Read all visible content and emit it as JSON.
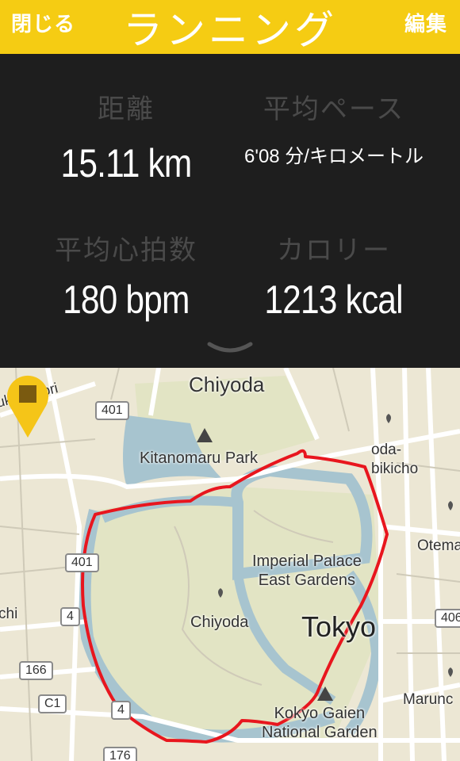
{
  "header": {
    "close_label": "閉じる",
    "title": "ランニング",
    "edit_label": "編集"
  },
  "stats": {
    "distance": {
      "label": "距離",
      "value": "15.11 km"
    },
    "pace": {
      "label": "平均ペース",
      "value": "6'08 分/キロメートル"
    },
    "heart_rate": {
      "label": "平均心拍数",
      "value": "180 bpm"
    },
    "calories": {
      "label": "カロリー",
      "value": "1213 kcal"
    }
  },
  "map": {
    "places": {
      "chiyoda_top": "Chiyoda",
      "kitanomaru_park": "Kitanomaru Park",
      "imperial_line1": "Imperial Palace",
      "imperial_line2": "East Gardens",
      "chiyoda_mid": "Chiyoda",
      "tokyo": "Tokyo",
      "kokyo_line1": "Kokyo Gaien",
      "kokyo_line2": "National Garden",
      "otema": "Otema",
      "marunouchi": "Marunc",
      "jimbocho_line1": "oda-",
      "jimbocho_line2": "bikicho",
      "yasukuni": "ukuni-dori",
      "chi": "chi"
    },
    "road_shields": {
      "r401a": "401",
      "r401b": "401",
      "r4a": "4",
      "r166": "166",
      "rc1": "C1",
      "r4b": "4",
      "r176": "176",
      "r406": "406"
    },
    "colors": {
      "route": "#e8161e",
      "water": "#a7c4cf",
      "park": "#e2e4c4",
      "pin": "#f5c518"
    }
  },
  "icons": {
    "expand": "chevron-down-icon",
    "pin": "location-pin-icon"
  }
}
